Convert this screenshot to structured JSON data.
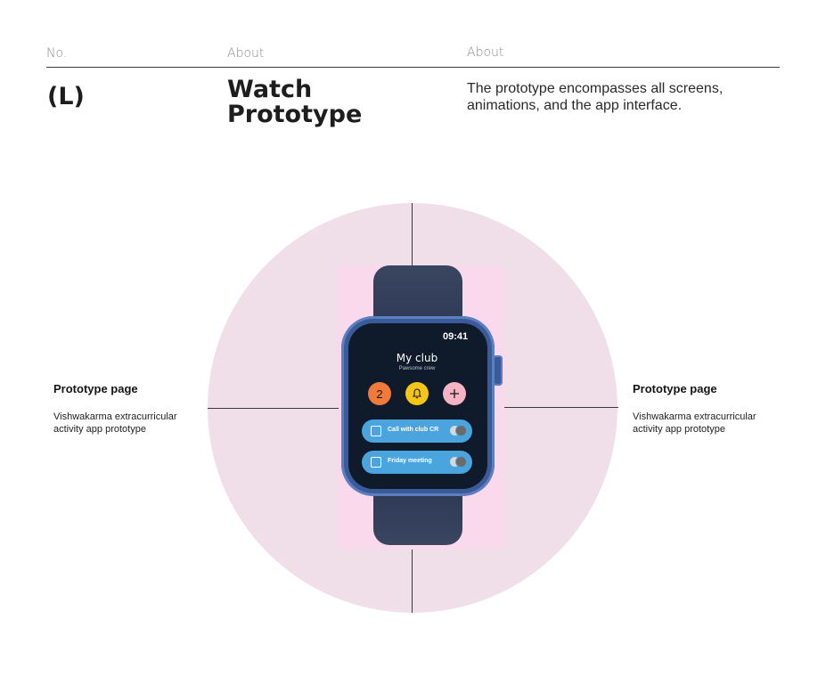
{
  "header": {
    "col1_label": "No.",
    "col2_label": "About",
    "col3_label": "About"
  },
  "project": {
    "code": "(L)",
    "title_line1": "Watch",
    "title_line2": "Prototype",
    "description": "The prototype encompasses all screens, animations, and the app interface."
  },
  "left_note": {
    "title": "Prototype page",
    "text": "Vishwakarma extracurricular activity app prototype"
  },
  "right_note": {
    "title": "Prototype page",
    "text": "Vishwakarma extracurricular activity app prototype"
  },
  "watch": {
    "time": "09:41",
    "club_title": "My club",
    "club_subtitle": "Pawsome crew",
    "badge_count": "2",
    "bell_icon": "bell-icon",
    "add_icon": "plus-icon",
    "tasks": [
      {
        "label": "Call with club CR"
      },
      {
        "label": "Friday meeting"
      }
    ]
  },
  "colors": {
    "circle": "#f0dfe9",
    "watch_backdrop": "#fad9ed",
    "badge_orange": "#f07a3a",
    "bell_yellow": "#f5c518",
    "plus_pink": "#f6b3c4",
    "task_blue": "#4aa4de"
  }
}
